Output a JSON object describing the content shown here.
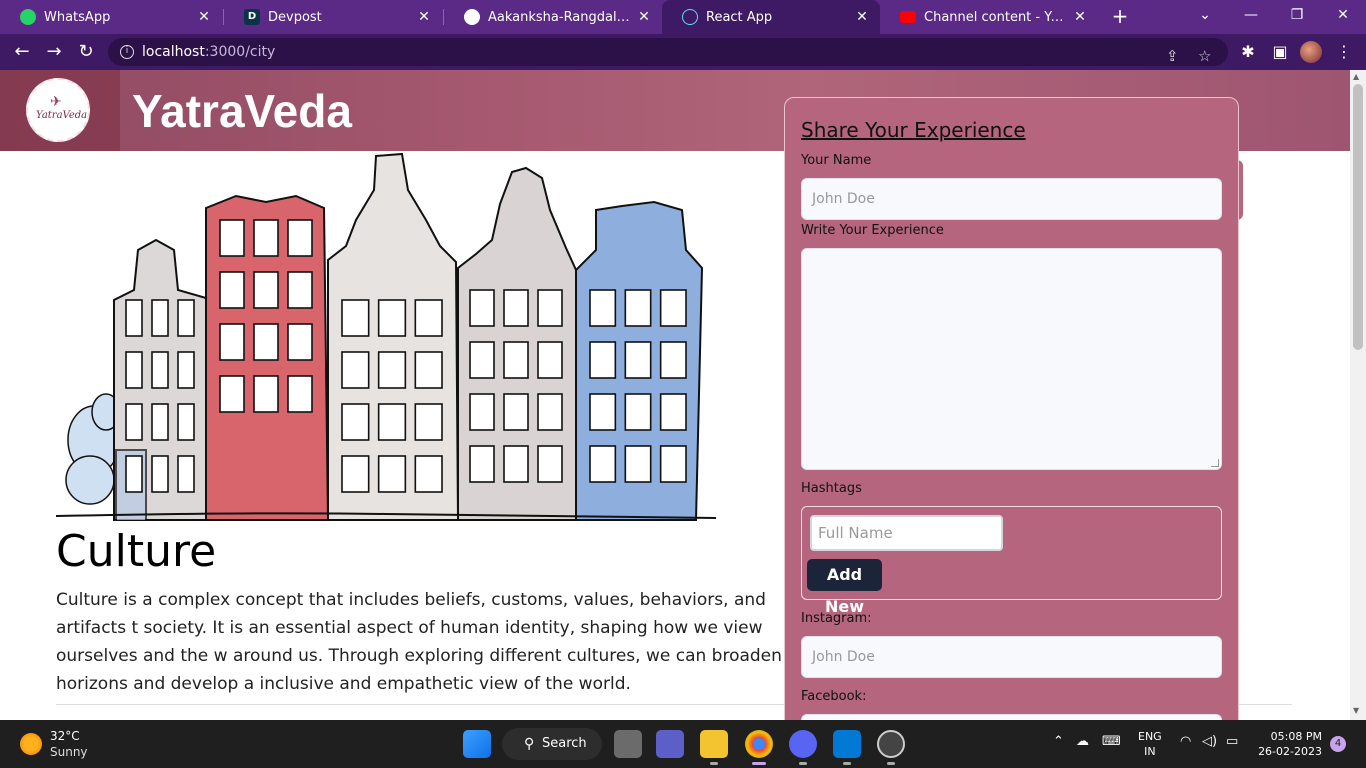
{
  "browser": {
    "tabs": [
      {
        "title": "WhatsApp",
        "icon": "whatsapp-icon",
        "color": "#25d366"
      },
      {
        "title": "Devpost",
        "icon": "devpost-icon",
        "color": "#003e54"
      },
      {
        "title": "Aakanksha-Rangdal/yatra-ve",
        "icon": "github-icon",
        "color": "#ffffff"
      },
      {
        "title": "React App",
        "icon": "react-icon",
        "color": "#61dafb"
      },
      {
        "title": "Channel content - YouTube S",
        "icon": "youtube-icon",
        "color": "#ff0000"
      }
    ],
    "active_tab_index": 3,
    "url_host": "localhost",
    "url_path": ":3000/city"
  },
  "site": {
    "brand": "YatraVeda",
    "logo_text": "YatraVeda"
  },
  "content": {
    "culture_title": "Culture",
    "culture_body": "Culture is a complex concept that includes beliefs, customs, values, behaviors, and artifacts t society. It is an essential aspect of human identity, shaping how we view ourselves and the w around us. Through exploring different cultures, we can broaden our horizons and develop a inclusive and empathetic view of the world."
  },
  "panel": {
    "title": "Share Your Experience",
    "name_label": "Your Name",
    "name_placeholder": "John Doe",
    "experience_label": "Write Your Experience",
    "hashtags_label": "Hashtags",
    "hashtag_placeholder": "Full Name",
    "add_button": "Add New",
    "instagram_label": "Instagram:",
    "instagram_placeholder": "John Doe",
    "facebook_label": "Facebook:"
  },
  "taskbar": {
    "temperature": "32°C",
    "weather": "Sunny",
    "search_label": "Search",
    "lang_line1": "ENG",
    "lang_line2": "IN",
    "time": "05:08 PM",
    "date": "26-02-2023",
    "notification_count": "4"
  },
  "colors": {
    "chrome": "#5b2a86",
    "header": "#a5586f",
    "panel": "#b5667e",
    "button_dark": "#1b2438"
  }
}
